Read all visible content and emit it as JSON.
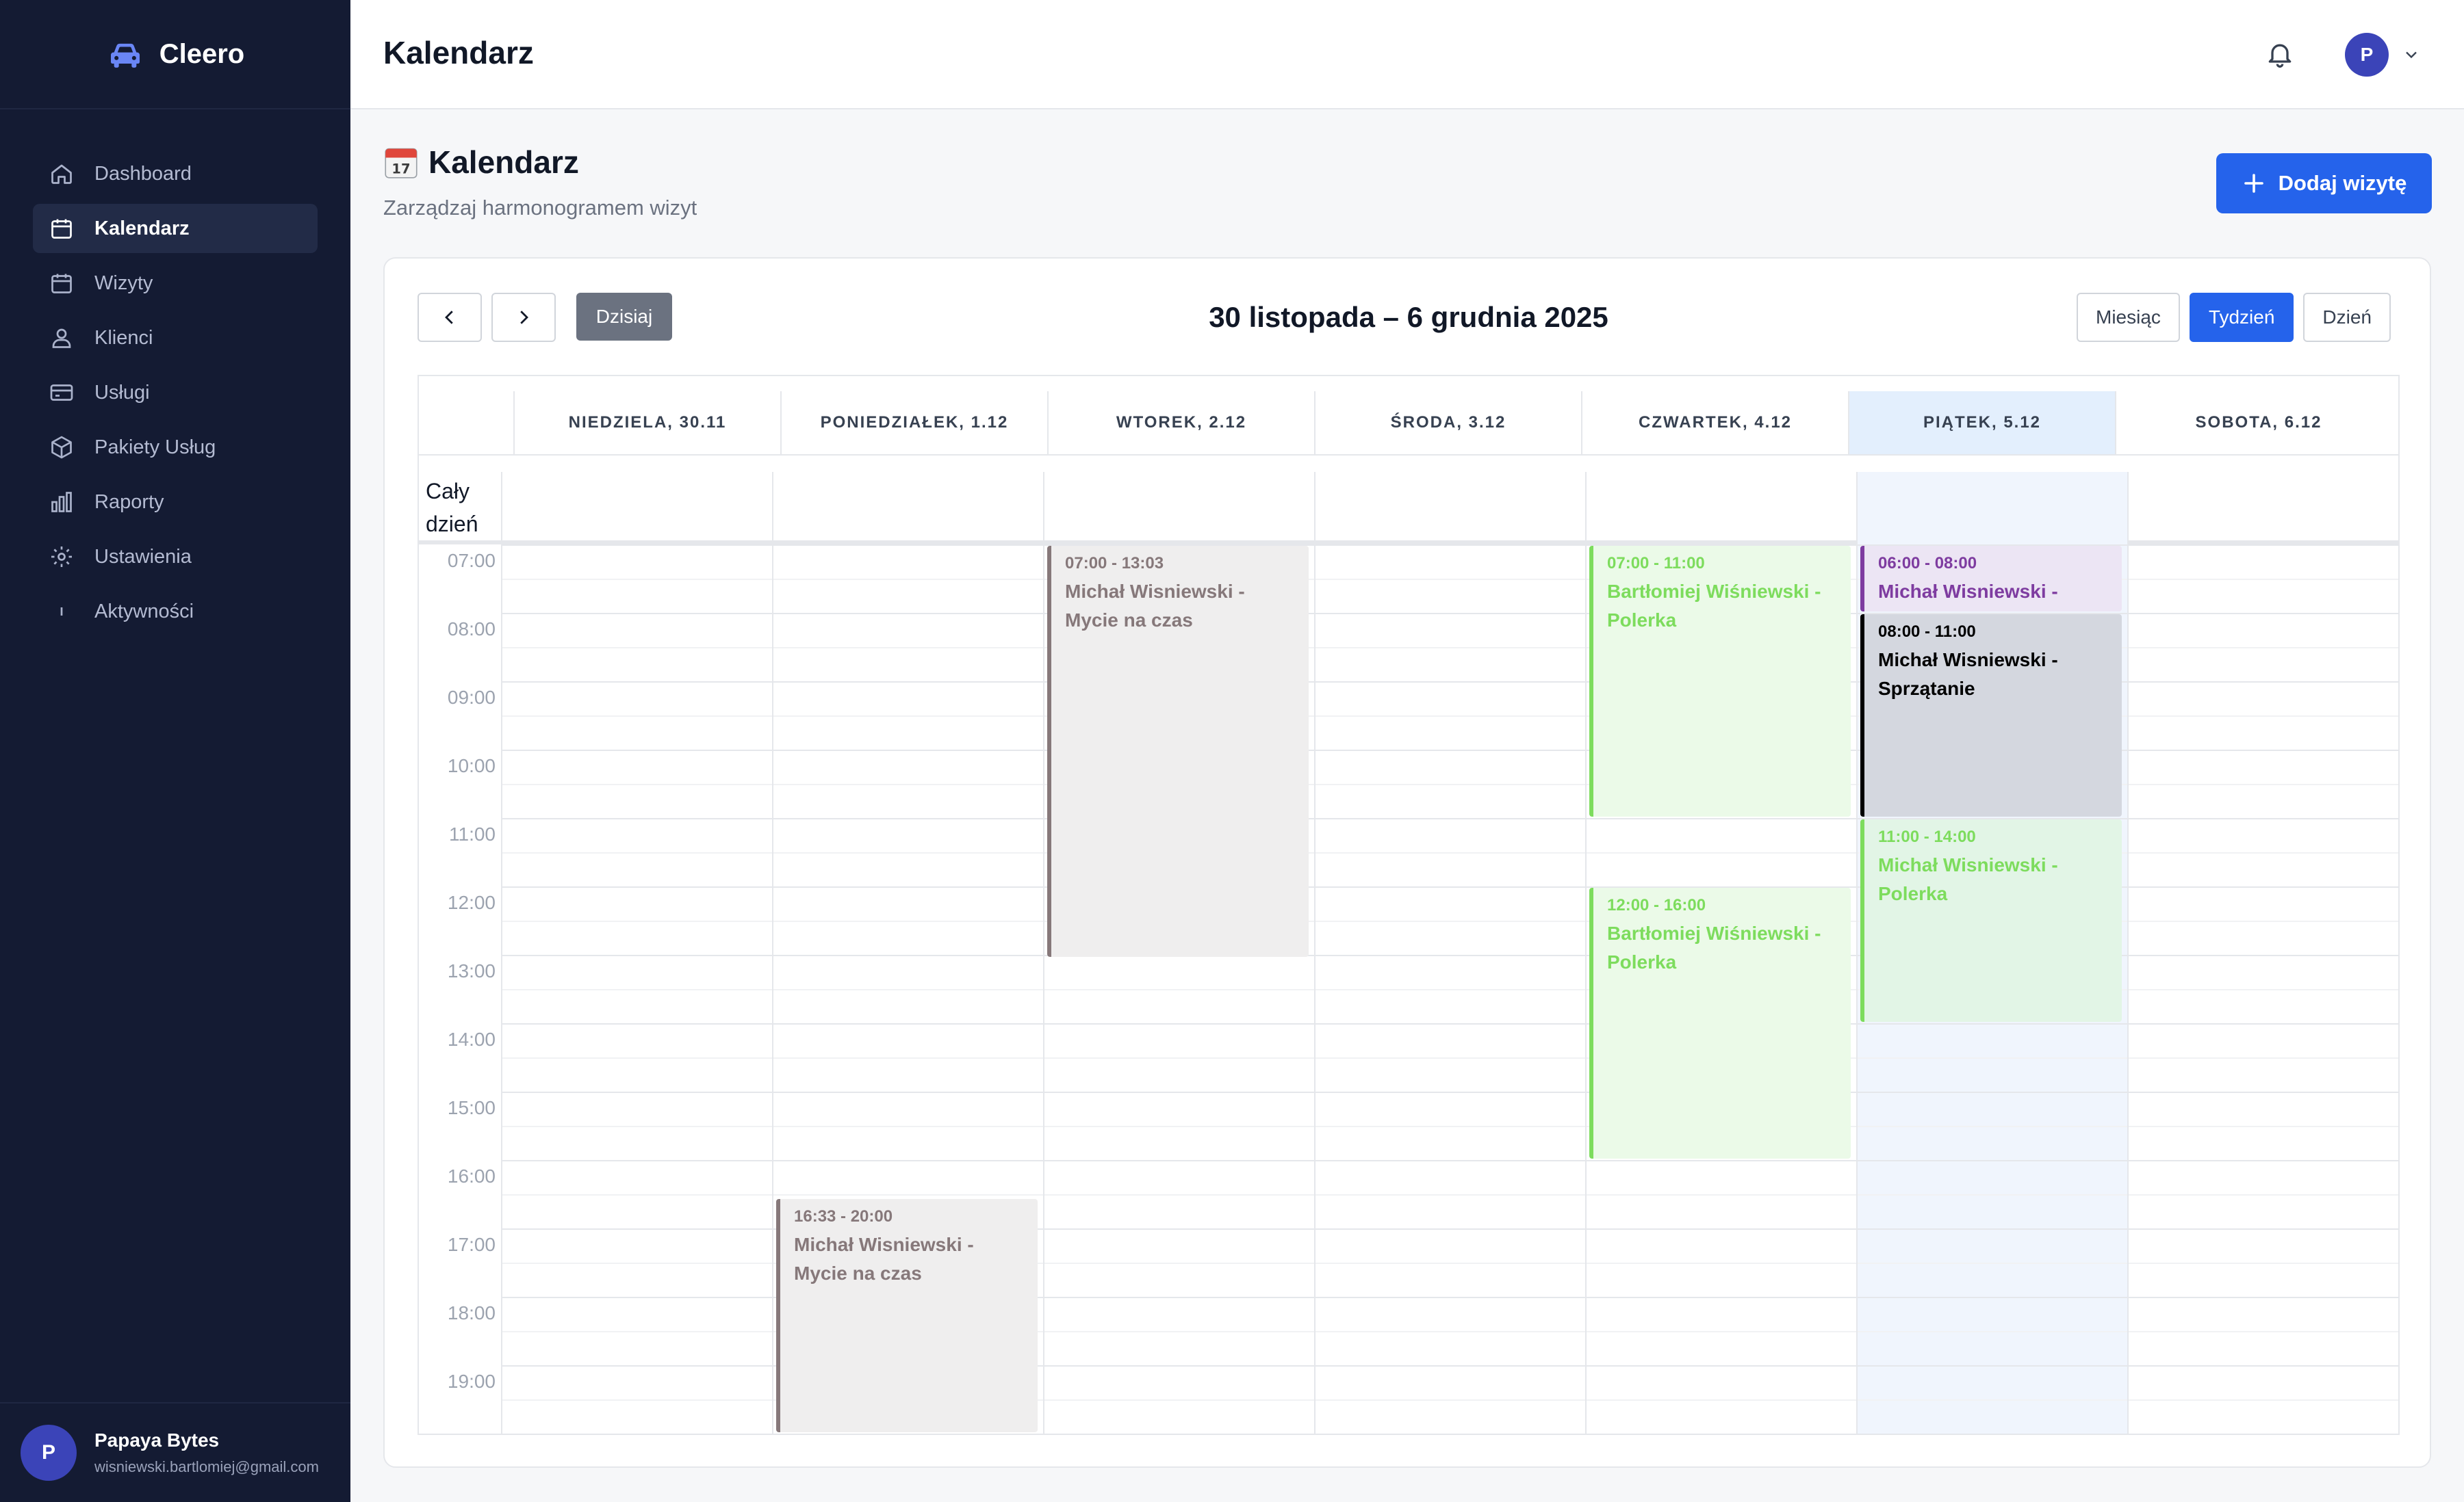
{
  "app": {
    "brand": "Cleero"
  },
  "sidebar": {
    "items": [
      {
        "label": "Dashboard",
        "icon": "home-icon"
      },
      {
        "label": "Kalendarz",
        "icon": "calendar-icon",
        "active": true
      },
      {
        "label": "Wizyty",
        "icon": "calendar-icon"
      },
      {
        "label": "Klienci",
        "icon": "user-icon"
      },
      {
        "label": "Usługi",
        "icon": "card-icon"
      },
      {
        "label": "Pakiety Usług",
        "icon": "box-icon"
      },
      {
        "label": "Raporty",
        "icon": "bar-chart-icon"
      },
      {
        "label": "Ustawienia",
        "icon": "gear-icon"
      },
      {
        "label": "Aktywności",
        "icon": "activity-icon"
      }
    ],
    "user": {
      "initial": "P",
      "name": "Papaya Bytes",
      "email": "wisniewski.bartlomiej@gmail.com"
    }
  },
  "topbar": {
    "title": "Kalendarz",
    "avatar_initial": "P"
  },
  "page": {
    "title": "Kalendarz",
    "subtitle": "Zarządzaj harmonogramem wizyt",
    "add_button": "Dodaj wizytę"
  },
  "toolbar": {
    "today": "Dzisiaj",
    "range": "30 listopada – 6 grudnia 2025",
    "views": [
      "Miesiąc",
      "Tydzień",
      "Dzień"
    ],
    "active_view": "Tydzień"
  },
  "calendar": {
    "allday_label": "Cały dzień",
    "days": [
      "Niedziela, 30.11",
      "Poniedziałek, 1.12",
      "Wtorek, 2.12",
      "Środa, 3.12",
      "Czwartek, 4.12",
      "Piątek, 5.12",
      "Sobota, 6.12"
    ],
    "today_index": 5,
    "hours": [
      "07:00",
      "08:00",
      "09:00",
      "10:00",
      "11:00",
      "12:00",
      "13:00",
      "14:00",
      "15:00",
      "16:00",
      "17:00",
      "18:00",
      "19:00"
    ],
    "events": [
      {
        "day": 1,
        "start": 16.55,
        "end": 20.0,
        "time": "16:33 - 20:00",
        "title": "Michał Wisniewski -\nMycie na czas",
        "style": "gray"
      },
      {
        "day": 2,
        "start": 7.0,
        "end": 13.05,
        "time": "07:00 - 13:03",
        "title": "Michał Wisniewski -\nMycie na czas",
        "style": "gray"
      },
      {
        "day": 4,
        "start": 7.0,
        "end": 11.0,
        "time": "07:00 - 11:00",
        "title": "Bartłomiej Wiśniewski -\nPolerka",
        "style": "green"
      },
      {
        "day": 4,
        "start": 12.0,
        "end": 16.0,
        "time": "12:00 - 16:00",
        "title": "Bartłomiej Wiśniewski -\nPolerka",
        "style": "green"
      },
      {
        "day": 5,
        "start": 7.0,
        "end": 8.0,
        "time": "06:00 - 08:00",
        "title": "Michał Wisniewski -",
        "style": "purple"
      },
      {
        "day": 5,
        "start": 8.0,
        "end": 11.0,
        "time": "08:00 - 11:00",
        "title": "Michał Wisniewski -\nSprzątanie",
        "style": "dark"
      },
      {
        "day": 5,
        "start": 11.0,
        "end": 14.0,
        "time": "11:00 - 14:00",
        "title": "Michał Wisniewski -\nPolerka",
        "style": "green2"
      }
    ]
  },
  "colors": {
    "accent": "#2563eb",
    "sidebar_bg": "#141b33",
    "today_bg": "#e3effd"
  }
}
